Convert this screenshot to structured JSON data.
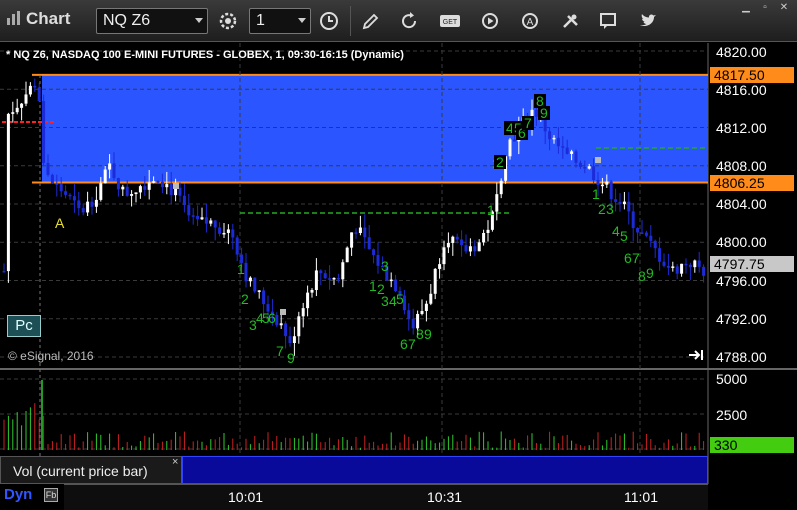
{
  "toolbar": {
    "title": "Chart",
    "symbol": "NQ Z6",
    "interval": "1",
    "icons": [
      "settings-icon",
      "clock-icon",
      "pencil-icon",
      "refresh-icon",
      "get-icon",
      "play-icon",
      "alert-icon",
      "draw-tools-icon",
      "chat-icon",
      "twitter-icon"
    ]
  },
  "window_controls": [
    "minimize",
    "restore",
    "close"
  ],
  "chart": {
    "header": "* NQ Z6, NASDAQ 100 E-MINI FUTURES - GLOBEX, 1, 09:30-16:15 (Dynamic)",
    "copyright": "© eSignal, 2016",
    "pc_button": "Pc",
    "annotation_a": "A",
    "price_axis": [
      "4820.00",
      "4816.00",
      "4812.00",
      "4808.00",
      "4804.00",
      "4800.00",
      "4796.00",
      "4792.00",
      "4788.00"
    ],
    "zone_high_tag": "4817.50",
    "zone_low_tag": "4806.25",
    "last_price_tag": "4797.75",
    "volume_axis": [
      "5000",
      "2500"
    ],
    "volume_tag": "330",
    "time_axis": [
      "10:01",
      "10:31",
      "11:01"
    ],
    "colors": {
      "zone": "#2a55ff",
      "zone_line": "#ff8c1a",
      "bull": "#ffffff",
      "bear": "#1c2bd8",
      "count": "#22bb22",
      "vol_up": "#2ecc2e",
      "vol_down": "#cc2222"
    }
  },
  "study": {
    "label": "Vol (current price bar)",
    "close": "×"
  },
  "footer": {
    "mode": "Dyn",
    "icon": "Fb"
  },
  "chart_data": {
    "type": "candlestick",
    "price_range": [
      4787.5,
      4820.5
    ],
    "zone": {
      "high": 4817.5,
      "low": 4806.25
    },
    "last_price": 4797.75,
    "volume_range": [
      0,
      5500
    ]
  }
}
